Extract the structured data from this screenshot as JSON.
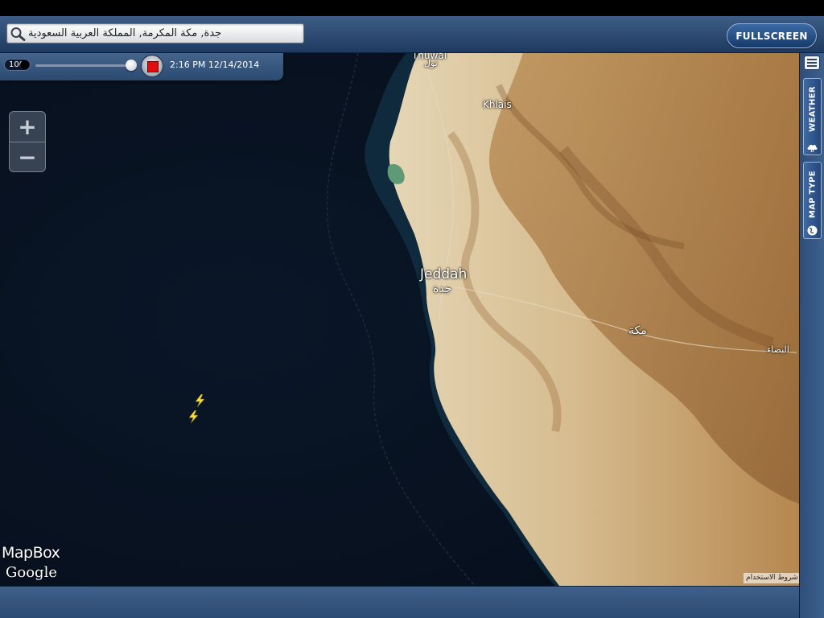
{
  "search": {
    "value": "جدة, مكة المكرمة, المملكة العربية السعودية"
  },
  "fullscreen_label": "FULLSCREEN",
  "timebar": {
    "speed": "100",
    "slider_position": 0.96,
    "timestamp": "2:16 PM   12/14/2014"
  },
  "zoom": {
    "in_label": "+",
    "out_label": "−"
  },
  "right_rail": {
    "weather_label": "WEATHER",
    "map_type_label": "MAP TYPE"
  },
  "map": {
    "places": {
      "thuwal_en": "Thuwal",
      "thuwal_ar": "ثول",
      "khlais": "Khlais",
      "jeddah_en": "Jeddah",
      "jeddah_ar": "جدة",
      "makkah_ar": "مكة",
      "albada_ar": "البضاء"
    },
    "lightning_icons": [
      "lightning-icon",
      "lightning-icon"
    ],
    "attribution": {
      "mapbox": "MapBox",
      "google": "Google",
      "terms": "شروط الاستخدام"
    }
  },
  "icons": {
    "search": "magnifier-icon",
    "stop": "stop-icon",
    "menu": "hamburger-icon",
    "weather": "cloud-icon",
    "map_type": "globe-icon"
  },
  "colors": {
    "sea": "#07111f",
    "land": "#d8c19a",
    "toolbar": "#2f4f7a",
    "stop": "#e20e0e",
    "lightning": "#f4e04a"
  }
}
